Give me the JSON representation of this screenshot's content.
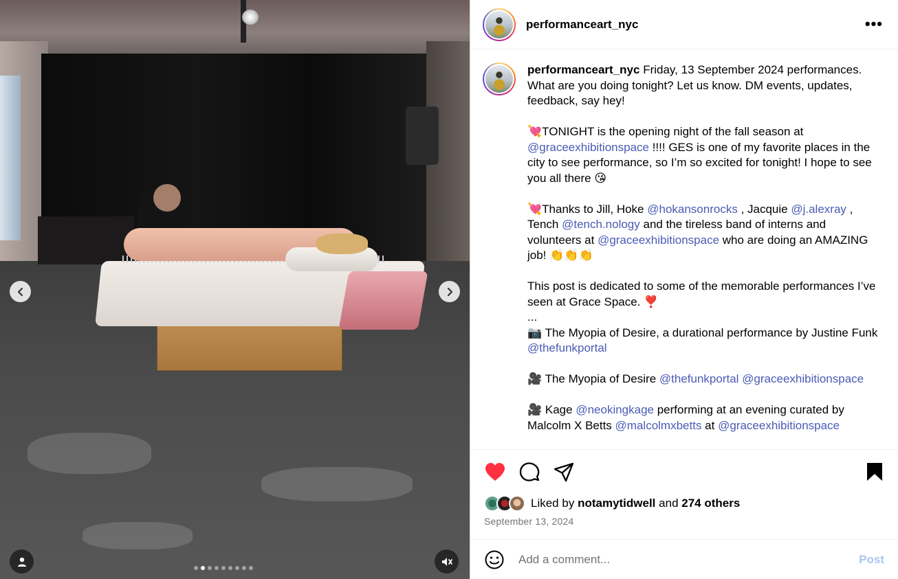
{
  "media": {
    "carousel_dots": 9,
    "active_dot": 1
  },
  "post": {
    "username": "performanceart_nyc",
    "more_label": "•••",
    "caption": {
      "username": "performanceart_nyc",
      "p1": " Friday, 13 September 2024 performances. What are you doing tonight? Let us know. DM events, updates, feedback, say hey!",
      "p2_a": "💘TONIGHT is the opening night of the fall season at ",
      "p2_mention": "@graceexhibitionspace",
      "p2_b": " !!!! GES is one of my favorite places in the city to see performance, so I’m so excited for tonight! I hope to see you all there 😘",
      "p3_a": "💘Thanks to Jill, Hoke ",
      "p3_m1": "@hokansonrocks",
      "p3_b": " , Jacquie ",
      "p3_m2": "@j.alexray",
      "p3_c": " , Tench ",
      "p3_m3": "@tench.nology",
      "p3_d": " and the tireless band of interns and volunteers at ",
      "p3_m4": "@graceexhibitionspace",
      "p3_e": " who are doing an AMAZING job! 👏👏👏",
      "p4": "This post is dedicated to some of the memorable performances I’ve seen at Grace Space. ❣️",
      "p5": "...",
      "p6_a": "📷 The Myopia of Desire, a durational performance by Justine Funk ",
      "p6_m": "@thefunkportal",
      "p7_a": "🎥 The Myopia of Desire ",
      "p7_m1": "@thefunkportal",
      "p7_m2": "@graceexhibitionspace",
      "p8_a": "🎥 Kage ",
      "p8_m1": "@neokingkage",
      "p8_b": " performing at an evening curated by Malcolm X Betts ",
      "p8_m2": "@malcolmxbetts",
      "p8_c": " at ",
      "p8_m3": "@graceexhibitionspace"
    },
    "likes": {
      "prefix": "Liked by ",
      "user": "notamytidwell",
      "middle": " and ",
      "others": "274 others"
    },
    "date": "September 13, 2024",
    "comment": {
      "placeholder": "Add a comment...",
      "post_label": "Post"
    }
  },
  "colors": {
    "like_red": "#ff3040",
    "mention_blue": "#4a5bb5",
    "post_button": "#a9c6f0"
  },
  "icons": [
    "chevron-left-icon",
    "chevron-right-icon",
    "user-icon",
    "mute-icon",
    "heart-icon",
    "comment-icon",
    "share-icon",
    "bookmark-icon",
    "emoji-icon"
  ]
}
